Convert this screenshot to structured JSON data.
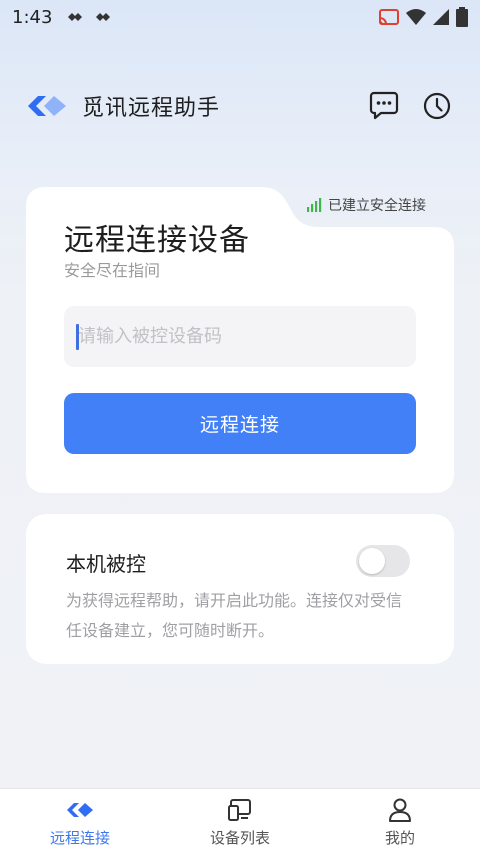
{
  "status_bar": {
    "time": "1:43"
  },
  "header": {
    "title": "觅讯远程助手"
  },
  "connect_card": {
    "secure_status": "已建立安全连接",
    "title": "远程连接设备",
    "subtitle": "安全尽在指间",
    "input_placeholder": "请输入被控设备码",
    "input_value": "",
    "connect_button_label": "远程连接"
  },
  "control_card": {
    "title": "本机被控",
    "description": "为获得远程帮助，请开启此功能。连接仅对受信任设备建立，您可随时断开。",
    "toggle_on": false
  },
  "bottom_nav": {
    "items": [
      {
        "label": "远程连接",
        "icon": "logo-icon",
        "active": true
      },
      {
        "label": "设备列表",
        "icon": "devices-icon",
        "active": false
      },
      {
        "label": "我的",
        "icon": "person-icon",
        "active": false
      }
    ]
  },
  "colors": {
    "accent": "#4280f7",
    "secure_green": "#3cb84a"
  }
}
